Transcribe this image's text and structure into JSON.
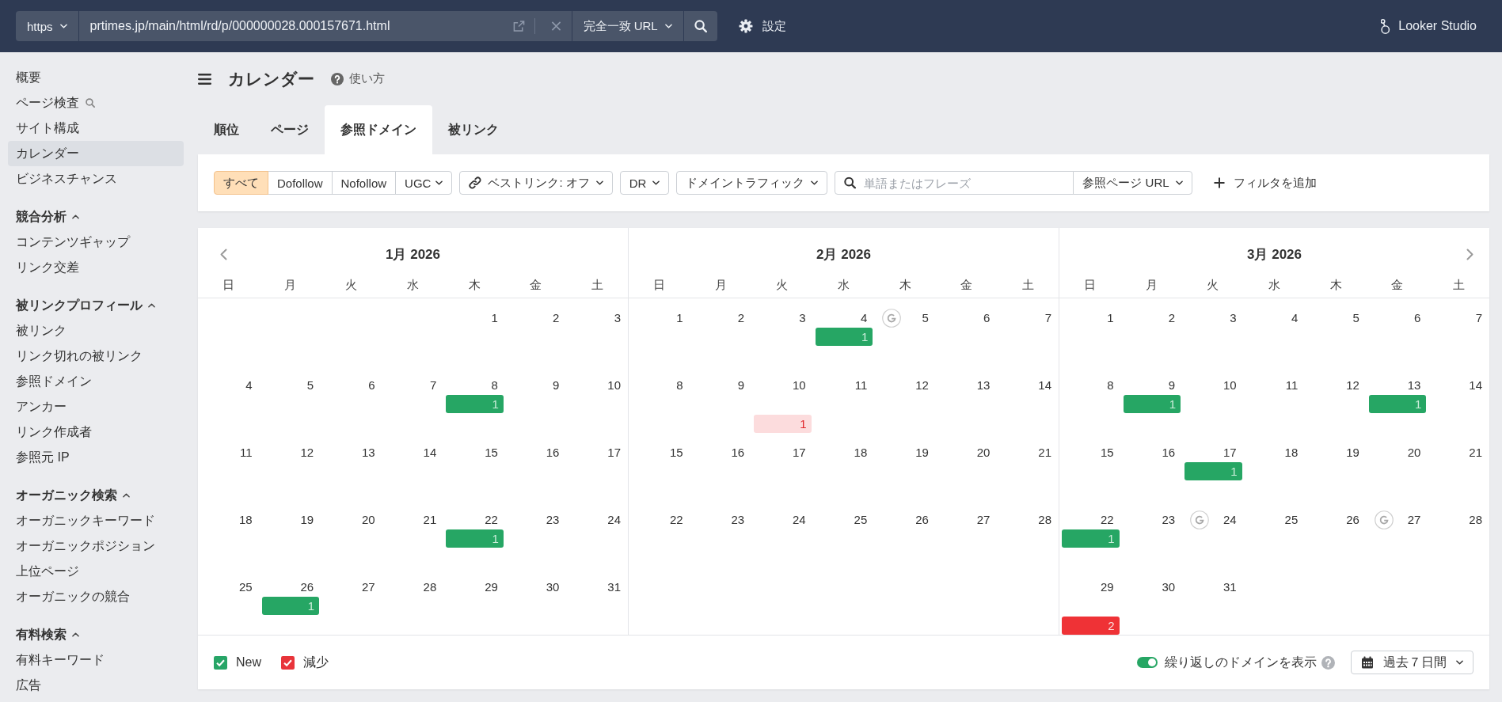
{
  "top_bar": {
    "protocol": {
      "label": "https"
    },
    "url": {
      "value": "prtimes.jp/main/html/rd/p/000000028.000157671.html"
    },
    "match_mode": {
      "label": "完全一致 URL"
    },
    "settings": {
      "label": "設定"
    },
    "looker_studio": {
      "label": "Looker Studio"
    }
  },
  "sidebar": {
    "items": [
      {
        "label": "概要",
        "kind": "plain",
        "selected": false
      },
      {
        "label": "ページ検査",
        "kind": "search",
        "selected": false
      },
      {
        "label": "サイト構成",
        "kind": "plain",
        "selected": false
      },
      {
        "label": "カレンダー",
        "kind": "plain",
        "selected": true
      },
      {
        "label": "ビジネスチャンス",
        "kind": "plain",
        "selected": false
      }
    ],
    "sections": [
      {
        "title": "競合分析",
        "expanded": true,
        "items": [
          {
            "label": "コンテンツギャップ",
            "selected": false
          },
          {
            "label": "リンク交差",
            "selected": false
          }
        ]
      },
      {
        "title": "被リンクプロフィール",
        "expanded": true,
        "items": [
          {
            "label": "被リンク",
            "selected": false
          },
          {
            "label": "リンク切れの被リンク",
            "selected": false
          },
          {
            "label": "参照ドメイン",
            "selected": false
          },
          {
            "label": "アンカー",
            "selected": false
          },
          {
            "label": "リンク作成者",
            "selected": false
          },
          {
            "label": "参照元 IP",
            "selected": false
          }
        ]
      },
      {
        "title": "オーガニック検索",
        "expanded": true,
        "items": [
          {
            "label": "オーガニックキーワード",
            "selected": false
          },
          {
            "label": "オーガニックポジション",
            "selected": false
          },
          {
            "label": "上位ページ",
            "selected": false
          },
          {
            "label": "オーガニックの競合",
            "selected": false
          }
        ]
      },
      {
        "title": "有料検索",
        "expanded": true,
        "items": [
          {
            "label": "有料キーワード",
            "selected": false
          },
          {
            "label": "広告",
            "selected": false
          }
        ]
      }
    ]
  },
  "header": {
    "title": "カレンダー",
    "help": "使い方"
  },
  "tabs": [
    {
      "label": "順位",
      "selected": false
    },
    {
      "label": "ページ",
      "selected": false
    },
    {
      "label": "参照ドメイン",
      "selected": true
    },
    {
      "label": "被リンク",
      "selected": false
    }
  ],
  "filters": {
    "link_types": [
      {
        "label": "すべて",
        "selected": true,
        "dropdown": false
      },
      {
        "label": "Dofollow",
        "selected": false,
        "dropdown": false
      },
      {
        "label": "Nofollow",
        "selected": false,
        "dropdown": false
      },
      {
        "label": "UGC",
        "selected": false,
        "dropdown": true
      }
    ],
    "best_links": {
      "label": "ベストリンク: オフ"
    },
    "dr": {
      "label": "DR"
    },
    "domain_traffic": {
      "label": "ドメイントラフィック"
    },
    "search": {
      "placeholder": "単語またはフレーズ",
      "scope": "参照ページ URL"
    },
    "add_filter": {
      "label": "フィルタを追加"
    }
  },
  "calendar": {
    "months": [
      {
        "title": "1月 2026",
        "weekdays": [
          "日",
          "月",
          "火",
          "水",
          "木",
          "金",
          "土"
        ],
        "weeks": [
          [
            {
              "day": "1",
              "marker": false
            },
            {
              "day": "2",
              "marker": false
            },
            {
              "day": "3",
              "marker": false
            }
          ],
          [
            {
              "day": "4",
              "marker": false
            },
            {
              "day": "5",
              "marker": false
            },
            {
              "day": "6",
              "marker": false
            },
            {
              "day": "7",
              "marker": false
            },
            {
              "day": "8",
              "marker": false,
              "events": [
                {
                  "kind": "new",
                  "count": "1",
                  "pale": false
                }
              ]
            },
            {
              "day": "9",
              "marker": false
            },
            {
              "day": "10",
              "marker": false
            }
          ],
          [
            {
              "day": "11",
              "marker": false
            },
            {
              "day": "12",
              "marker": false
            },
            {
              "day": "13",
              "marker": false
            },
            {
              "day": "14",
              "marker": false
            },
            {
              "day": "15",
              "marker": false
            },
            {
              "day": "16",
              "marker": false
            },
            {
              "day": "17",
              "marker": false
            }
          ],
          [
            {
              "day": "18",
              "marker": false
            },
            {
              "day": "19",
              "marker": false
            },
            {
              "day": "20",
              "marker": false
            },
            {
              "day": "21",
              "marker": false
            },
            {
              "day": "22",
              "marker": false,
              "events": [
                {
                  "kind": "new",
                  "count": "1",
                  "pale": false
                }
              ]
            },
            {
              "day": "23",
              "marker": false
            },
            {
              "day": "24",
              "marker": false
            }
          ],
          [
            {
              "day": "25",
              "marker": false
            },
            {
              "day": "26",
              "marker": false,
              "events": [
                {
                  "kind": "new",
                  "count": "1",
                  "pale": false
                }
              ]
            },
            {
              "day": "27",
              "marker": false
            },
            {
              "day": "28",
              "marker": false
            },
            {
              "day": "29",
              "marker": false
            },
            {
              "day": "30",
              "marker": false
            },
            {
              "day": "31",
              "marker": false
            }
          ]
        ]
      },
      {
        "title": "2月 2026",
        "weekdays": [
          "日",
          "月",
          "火",
          "水",
          "木",
          "金",
          "土"
        ],
        "weeks": [
          [
            {
              "day": "1",
              "marker": false
            },
            {
              "day": "2",
              "marker": false
            },
            {
              "day": "3",
              "marker": false
            },
            {
              "day": "4",
              "marker": false,
              "events": [
                {
                  "kind": "new",
                  "count": "1",
                  "pale": false
                }
              ]
            },
            {
              "day": "5",
              "marker": true
            },
            {
              "day": "6",
              "marker": false
            },
            {
              "day": "7",
              "marker": false
            }
          ],
          [
            {
              "day": "8",
              "marker": false
            },
            {
              "day": "9",
              "marker": false
            },
            {
              "day": "10",
              "marker": false,
              "events": [
                {
                  "kind": "lost",
                  "count": "1",
                  "pale": true
                }
              ]
            },
            {
              "day": "11",
              "marker": false
            },
            {
              "day": "12",
              "marker": false
            },
            {
              "day": "13",
              "marker": false
            },
            {
              "day": "14",
              "marker": false
            }
          ],
          [
            {
              "day": "15",
              "marker": false
            },
            {
              "day": "16",
              "marker": false
            },
            {
              "day": "17",
              "marker": false
            },
            {
              "day": "18",
              "marker": false
            },
            {
              "day": "19",
              "marker": false
            },
            {
              "day": "20",
              "marker": false
            },
            {
              "day": "21",
              "marker": false
            }
          ],
          [
            {
              "day": "22",
              "marker": false
            },
            {
              "day": "23",
              "marker": false
            },
            {
              "day": "24",
              "marker": false
            },
            {
              "day": "25",
              "marker": false
            },
            {
              "day": "26",
              "marker": false
            },
            {
              "day": "27",
              "marker": false
            },
            {
              "day": "28",
              "marker": false
            }
          ]
        ]
      },
      {
        "title": "3月 2026",
        "weekdays": [
          "日",
          "月",
          "火",
          "水",
          "木",
          "金",
          "土"
        ],
        "weeks": [
          [
            {
              "day": "1",
              "marker": false
            },
            {
              "day": "2",
              "marker": false
            },
            {
              "day": "3",
              "marker": false
            },
            {
              "day": "4",
              "marker": false
            },
            {
              "day": "5",
              "marker": false
            },
            {
              "day": "6",
              "marker": false
            },
            {
              "day": "7",
              "marker": false
            }
          ],
          [
            {
              "day": "8",
              "marker": false
            },
            {
              "day": "9",
              "marker": false,
              "events": [
                {
                  "kind": "new",
                  "count": "1",
                  "pale": false
                }
              ]
            },
            {
              "day": "10",
              "marker": false
            },
            {
              "day": "11",
              "marker": false
            },
            {
              "day": "12",
              "marker": false
            },
            {
              "day": "13",
              "marker": false,
              "events": [
                {
                  "kind": "new",
                  "count": "1",
                  "pale": false
                }
              ]
            },
            {
              "day": "14",
              "marker": false
            }
          ],
          [
            {
              "day": "15",
              "marker": false
            },
            {
              "day": "16",
              "marker": false
            },
            {
              "day": "17",
              "marker": false,
              "events": [
                {
                  "kind": "new",
                  "count": "1",
                  "pale": false
                }
              ]
            },
            {
              "day": "18",
              "marker": false
            },
            {
              "day": "19",
              "marker": false
            },
            {
              "day": "20",
              "marker": false
            },
            {
              "day": "21",
              "marker": false
            }
          ],
          [
            {
              "day": "22",
              "marker": false,
              "events": [
                {
                  "kind": "new",
                  "count": "1",
                  "pale": false
                }
              ]
            },
            {
              "day": "23",
              "marker": false
            },
            {
              "day": "24",
              "marker": true
            },
            {
              "day": "25",
              "marker": false
            },
            {
              "day": "26",
              "marker": false
            },
            {
              "day": "27",
              "marker": true
            },
            {
              "day": "28",
              "marker": false
            }
          ],
          [
            {
              "day": "29",
              "marker": false,
              "events": [
                {
                  "kind": "lost",
                  "count": "2",
                  "pale": false
                }
              ]
            },
            {
              "day": "30",
              "marker": false
            },
            {
              "day": "31",
              "marker": false
            }
          ]
        ]
      }
    ]
  },
  "legend": [
    {
      "label": "New",
      "checked": true,
      "color": "#27a567"
    },
    {
      "label": "減少",
      "checked": true,
      "color": "#e8343a"
    }
  ],
  "repeat_toggle": {
    "label": "繰り返しのドメインを表示",
    "on": true
  },
  "period": {
    "label": "過去７日間"
  }
}
